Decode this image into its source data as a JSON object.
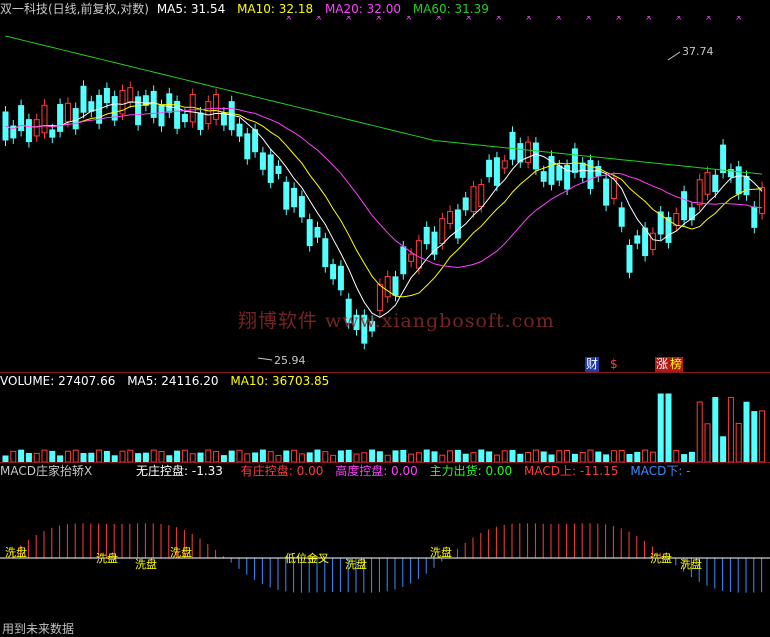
{
  "price_panel": {
    "title": "双一科技(日线,前复权,对数)",
    "ma5": "MA5: 31.54",
    "ma10": "MA10: 32.18",
    "ma20": "MA20: 32.00",
    "ma60": "MA60: 31.39",
    "high_label": "37.74",
    "low_label": "25.94",
    "watermark": "翔博软件 www.xiangbosoft.com",
    "badges": [
      "财",
      "$",
      "涨",
      "榜"
    ],
    "colors": {
      "up": "#ff3c3c",
      "down": "#54ffff",
      "ma5": "#ffffff",
      "ma10": "#ffff00",
      "ma20": "#ff40ff",
      "ma60": "#20d020"
    }
  },
  "volume_panel": {
    "volume": "VOLUME: 27407.66",
    "ma5": "MA5: 24116.20",
    "ma10": "MA10: 36703.85"
  },
  "macd_panel": {
    "title": "MACD庄家抬轿X",
    "wuzhuang": "无庄控盘: -1.33",
    "youzhuang": "有庄控盘: 0.00",
    "gaodu": "高度控盘: 0.00",
    "zhuli": "主力出货: 0.00",
    "macd_up": "MACD上: -11.15",
    "macd_down": "MACD下: -",
    "markers": [
      "洗盘",
      "洗盘",
      "洗盘",
      "洗盘",
      "低位金叉",
      "洗盘",
      "洗盘",
      "洗盘",
      "洗盘"
    ]
  },
  "footer": "用到未来数据"
}
